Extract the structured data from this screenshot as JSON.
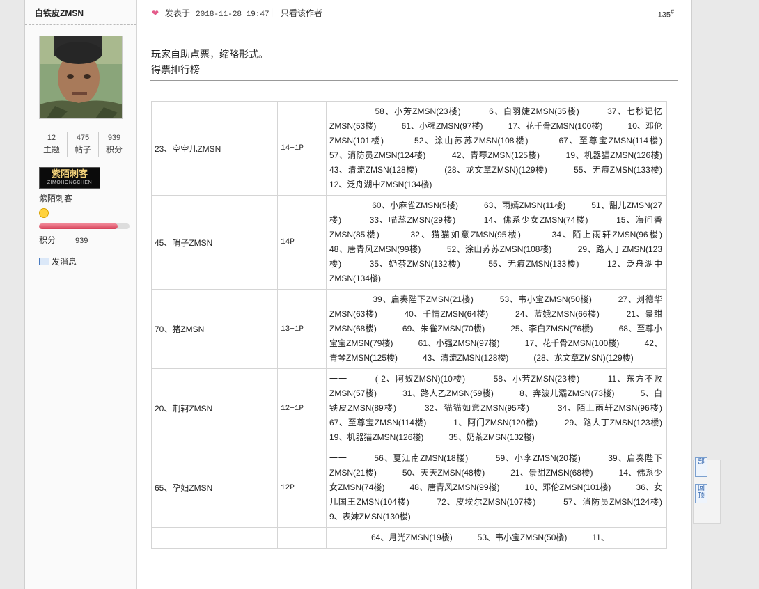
{
  "user": {
    "name": "白铁皮ZMSN",
    "stats": [
      {
        "value": "12",
        "label": "主题"
      },
      {
        "value": "475",
        "label": "帖子"
      },
      {
        "value": "939",
        "label": "积分"
      }
    ],
    "medal_title": "紫陌刺客",
    "medal_sub": "ZIMOHONGCHEN",
    "group": "紫陌刺客",
    "level_progress": 0.87,
    "points_label": "积分",
    "points_value": "939",
    "send_message": "发消息"
  },
  "post": {
    "posted_label": "发表于",
    "time": "2018-11-28 19:47",
    "only_author": "只看该作者",
    "floor_number": "135",
    "floor_suffix": "#",
    "intro_line1": "玩家自助点票，缩略形式。",
    "intro_line2": "得票排行榜"
  },
  "votes": [
    {
      "name": "23、空空儿ZMSN",
      "count": "14+1P",
      "detail": "一一　　　58、小芳ZMSN(23楼)　　　6、白羽婕ZMSN(35楼)　　　37、七秒记忆ZMSN(53楼)　　　61、小强ZMSN(97楼)　　　17、花千骨ZMSN(100楼)　　　10、邓伦ZMSN(101楼)　　　52、涂山苏苏ZMSN(108楼)　　　67、至尊宝ZMSN(114楼)　　　57、消防员ZMSN(124楼)　　　42、青琴ZMSN(125楼)　　　19、机器猫ZMSN(126楼)　　　43、清流ZMSN(128楼)　　　(28、龙文章ZMSN)(129楼)　　　55、无痕ZMSN(133楼)　　　12、泛舟湖中ZMSN(134楼)"
    },
    {
      "name": "45、哨子ZMSN",
      "count": "14P",
      "detail": "一一　　　60、小麻雀ZMSN(5楼)　　　63、雨嫣ZMSN(11楼)　　　51、甜儿ZMSN(27楼)　　　33、喵蕊ZMSN(29楼)　　　14、佛系少女ZMSN(74楼)　　　15、海问香ZMSN(85楼)　　　32、猫猫如意ZMSN(95楼)　　　34、陌上雨轩ZMSN(96楼)　　　48、唐青风ZMSN(99楼)　　　52、涂山苏苏ZMSN(108楼)　　　29、路人丁ZMSN(123楼)　　　35、奶茶ZMSN(132楼)　　　55、无痕ZMSN(133楼)　　　12、泛舟湖中ZMSN(134楼)"
    },
    {
      "name": "70、猪ZMSN",
      "count": "13+1P",
      "detail": "一一　　　39、启奏陛下ZMSN(21楼)　　　53、韦小宝ZMSN(50楼)　　　27、刘德华ZMSN(63楼)　　　40、千情ZMSN(64楼)　　　24、蓝娥ZMSN(66楼)　　　21、景甜ZMSN(68楼)　　　69、朱雀ZMSN(70楼)　　　25、李白ZMSN(76楼)　　　68、至尊小宝宝ZMSN(79楼)　　　61、小强ZMSN(97楼)　　　17、花千骨ZMSN(100楼)　　　42、青琴ZMSN(125楼)　　　43、清流ZMSN(128楼)　　　(28、龙文章ZMSN)(129楼)"
    },
    {
      "name": "20、荆轲ZMSN",
      "count": "12+1P",
      "detail": "一一　　　( 2、阿奴ZMSN)(10楼)　　　58、小芳ZMSN(23楼)　　　11、东方不败ZMSN(57楼)　　　31、路人乙ZMSN(59楼)　　　8、奔波儿灞ZMSN(73楼)　　　5、白铁皮ZMSN(89楼)　　　32、猫猫如意ZMSN(95楼)　　　34、陌上雨轩ZMSN(96楼)　　　67、至尊宝ZMSN(114楼)　　　1、阿门ZMSN(120楼)　　　29、路人丁ZMSN(123楼)　　　19、机器猫ZMSN(126楼)　　　35、奶茶ZMSN(132楼)"
    },
    {
      "name": "65、孕妇ZMSN",
      "count": "12P",
      "detail": "一一　　　56、夏江南ZMSN(18楼)　　　59、小李ZMSN(20楼)　　　39、启奏陛下ZMSN(21楼)　　　50、天天ZMSN(48楼)　　　21、景甜ZMSN(68楼)　　　14、佛系少女ZMSN(74楼)　　　48、唐青风ZMSN(99楼)　　　10、邓伦ZMSN(101楼)　　　36、女儿国王ZMSN(104楼)　　　72、皮埃尔ZMSN(107楼)　　　57、消防员ZMSN(124楼)　　　9、表妹ZMSN(130楼)"
    },
    {
      "name": "",
      "count": "",
      "detail": "一一　　　64、月光ZMSN(19楼)　　　53、韦小宝ZMSN(50楼)　　　11、"
    }
  ],
  "float_buttons": [
    "部",
    "回顶"
  ]
}
